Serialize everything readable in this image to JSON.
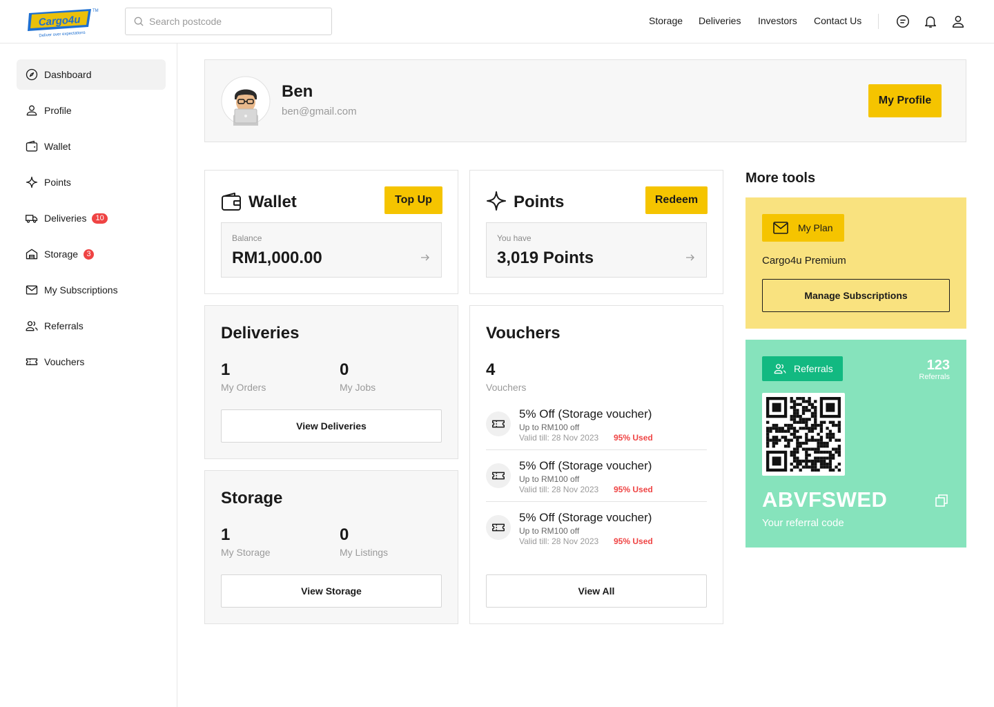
{
  "brand": {
    "logo_text": "Cargo4u",
    "tagline": "Deliver over expectations",
    "trademark": "TM",
    "accent": "#f5c400",
    "blue": "#1d6fd1"
  },
  "search": {
    "placeholder": "Search postcode",
    "value": ""
  },
  "topnav": [
    "Storage",
    "Deliveries",
    "Investors",
    "Contact Us"
  ],
  "header_icons": [
    "chat-icon",
    "bell-icon",
    "user-icon"
  ],
  "sidebar": {
    "items": [
      {
        "label": "Dashboard",
        "icon": "compass-icon",
        "active": true,
        "badge": ""
      },
      {
        "label": "Profile",
        "icon": "user-icon",
        "badge": ""
      },
      {
        "label": "Wallet",
        "icon": "wallet-icon",
        "badge": ""
      },
      {
        "label": "Points",
        "icon": "sparkle-icon",
        "badge": ""
      },
      {
        "label": "Deliveries",
        "icon": "truck-icon",
        "badge": "10"
      },
      {
        "label": "Storage",
        "icon": "warehouse-icon",
        "badge": "3"
      },
      {
        "label": "My Subscriptions",
        "icon": "mail-icon",
        "badge": ""
      },
      {
        "label": "Referrals",
        "icon": "users-icon",
        "badge": ""
      },
      {
        "label": "Vouchers",
        "icon": "ticket-icon",
        "badge": ""
      }
    ]
  },
  "profile": {
    "name": "Ben",
    "email": "ben@gmail.com",
    "button": "My Profile"
  },
  "wallet": {
    "title": "Wallet",
    "button": "Top Up",
    "label": "Balance",
    "value": "RM1,000.00"
  },
  "points": {
    "title": "Points",
    "button": "Redeem",
    "label": "You have",
    "value": "3,019 Points"
  },
  "deliveries": {
    "title": "Deliveries",
    "stats": [
      {
        "value": "1",
        "label": "My Orders"
      },
      {
        "value": "0",
        "label": "My Jobs"
      }
    ],
    "button": "View Deliveries"
  },
  "storage": {
    "title": "Storage",
    "stats": [
      {
        "value": "1",
        "label": "My Storage"
      },
      {
        "value": "0",
        "label": "My Listings"
      }
    ],
    "button": "View Storage"
  },
  "vouchers": {
    "title": "Vouchers",
    "count": "4",
    "count_label": "Vouchers",
    "items": [
      {
        "title": "5% Off (Storage voucher)",
        "sub": "Up to RM100 off",
        "valid": "Valid till: 28 Nov 2023",
        "used": "95% Used"
      },
      {
        "title": "5% Off (Storage voucher)",
        "sub": "Up to RM100 off",
        "valid": "Valid till: 28 Nov 2023",
        "used": "95% Used"
      },
      {
        "title": "5% Off (Storage voucher)",
        "sub": "Up to RM100 off",
        "valid": "Valid till: 28 Nov 2023",
        "used": "95% Used"
      }
    ],
    "button": "View All"
  },
  "more_tools": {
    "title": "More tools",
    "plan": {
      "button": "My Plan",
      "name": "Cargo4u Premium",
      "manage": "Manage Subscriptions",
      "bg": "#f9e27f"
    },
    "referrals": {
      "button": "Referrals",
      "count": "123",
      "count_label": "Referrals",
      "code": "ABVFSWED",
      "code_label": "Your referral code",
      "bg": "#86e3bc",
      "button_bg": "#12b981"
    }
  }
}
